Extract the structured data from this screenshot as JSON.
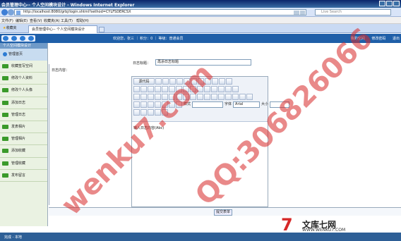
{
  "browser": {
    "window_title": "会员管理中心-- 个人空间模块设计 - Windows Internet Explorer",
    "address": "http://localhost:8080/grbj/login.shtml?sethod=CYLFSDERCSX",
    "search_placeholder": "Live Search",
    "menu": [
      "文件(F)",
      "编辑(E)",
      "查看(V)",
      "收藏夹(A)",
      "工具(T)",
      "帮助(H)"
    ],
    "favorites_label": "收藏夹",
    "tab_label": "会员管理中心-- 个人空间模块设计"
  },
  "site": {
    "info": "欢迎您，张三 ｜ 积分：0 ｜ 等级：普通会员",
    "links": [
      "我的空间",
      "修改密码",
      "退出"
    ]
  },
  "sidebar": {
    "header": "个人空间模块设计",
    "home": "管理首页",
    "items": [
      "收藏签写空间",
      "修改个人资料",
      "修改个人头像",
      "添加日志",
      "管理日志",
      "发表相片",
      "管理相片",
      "添加收藏",
      "管理收藏",
      "发布留言"
    ]
  },
  "form": {
    "content_label": "日志内容：",
    "title_label": "日志标题：",
    "title_value": "再添日志标题",
    "source_button": "源代码",
    "style_label": "样式",
    "font_label": "字体",
    "font_value": "Arial",
    "size_label": "大小",
    "editor_text": "输入日志内容(Abc)",
    "submit_label": "提交表单"
  },
  "status": {
    "text": "完成 - 本地"
  },
  "watermarks": {
    "site": "wenku7.com",
    "qq": "QQ:306826066",
    "logo_mark": "7",
    "logo_cn": "文库七网",
    "logo_url": "WWW.WENKU7.COM"
  }
}
